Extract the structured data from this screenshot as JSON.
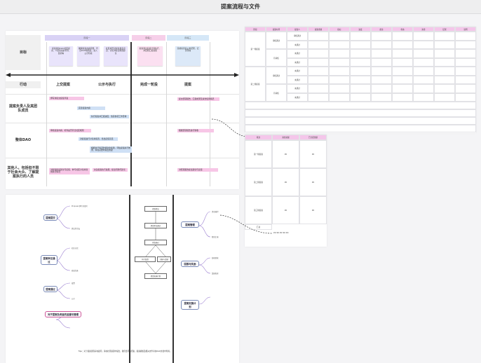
{
  "page": {
    "title": "提案流程与文件"
  },
  "flow": {
    "row_labels": {
      "purpose": "目标",
      "action": "行动",
      "proposers": "提案负责人及其团队成员",
      "dao": "整体DAO",
      "others": "其他人，包括但不限于社会大众、了解提案执行的人员"
    },
    "phase_headers": [
      "阶段一",
      "阶段二",
      "阶段三"
    ],
    "phases": [
      "上交提案",
      "公示与执行",
      "完成一轮投",
      "提案"
    ],
    "stickies": [
      "提案者向DAO社区提交，介绍提案的背景、目的等",
      "确保提案内容完整、符合DAO规则后，进入公示阶段",
      "社区成员就提案发表意见、讨论并提出修改建议",
      "提案通过后按计划执行，并定期汇报进展",
      "完成投票后公布结果，记录存档"
    ],
    "bars": [
      "撰写并提交提案草案",
      "完善提案内容",
      "执行提案并汇报进度，落实各项工作安排",
      "提交结项报告，汇报成果及资金使用情况",
      "审核提案内容，检查是否符合社区规则",
      "对提案进行讨论并投票，给出反馈意见",
      "根据执行情况监督资金使用，评估提案执行效果，并在必要时提出质疑",
      "根据结项报告进行验收",
      "对提案提出建议与反馈，参与社区讨论并监督执行情况",
      "关注提案执行进展，提出问题与建议",
      "对结项报告提出建议与反馈"
    ]
  },
  "mind": {
    "nodes": [
      "提案提交",
      "提案审议通过",
      "提案通过",
      "执行监督",
      "对于提案及资金的监督与管理",
      "提案管理",
      "回报与奖励",
      "提案实施计划"
    ],
    "leaves": [
      "Proposal 撰写并填写",
      "提交至论坛",
      "社区讨论",
      "修改完善",
      "投票",
      "公示",
      "资金拨付",
      "阶段汇报",
      "结项验收",
      "奖励发放"
    ],
    "caption": "Tips：对于提案流程存在疑问，请在社区频道中提出，我们会尽快回复。提案模板及相关文件可在DAO文档中查阅。"
  },
  "table1": {
    "headers": [
      "阶段",
      "提案时间",
      "提案人",
      "提案金额",
      "指标",
      "进度",
      "备注",
      "状态",
      "资金",
      "结果",
      "说明"
    ],
    "groups": [
      "第一轮提案",
      "第二轮提案"
    ],
    "subgroups": [
      "审核通过",
      "待审核",
      "审核通过",
      "待审核"
    ],
    "rowlabels": [
      "审核通过",
      "未通过",
      "未通过",
      "未通过",
      "未通过",
      "未通过",
      "未通过",
      "未通过"
    ]
  },
  "table2": {
    "headers": [
      "轮次",
      "资金总额",
      "已分配金额"
    ],
    "rows": [
      {
        "label": "第一轮提案",
        "a": "¥0",
        "b": "¥0"
      },
      {
        "label": "第二轮提案",
        "a": "¥0",
        "b": "¥0"
      },
      {
        "label": "第三轮提案",
        "a": "¥0",
        "b": "¥0"
      }
    ],
    "total_label": "汇总",
    "total_note": "¥0 ¥0 ¥0 ¥0 ¥0"
  }
}
